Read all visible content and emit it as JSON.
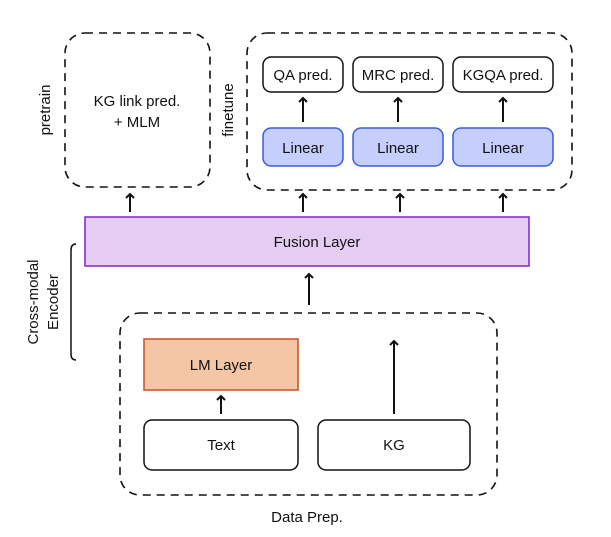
{
  "pretrain": {
    "label": "pretrain",
    "task_line1": "KG link pred.",
    "task_line2": "+ MLM"
  },
  "finetune": {
    "label": "finetune",
    "heads": [
      {
        "pred": "QA pred.",
        "layer": "Linear"
      },
      {
        "pred": "MRC pred.",
        "layer": "Linear"
      },
      {
        "pred": "KGQA pred.",
        "layer": "Linear"
      }
    ]
  },
  "fusion": {
    "label": "Fusion Layer"
  },
  "encoder": {
    "label_line1": "Cross-modal",
    "label_line2": "Encoder"
  },
  "data_prep": {
    "label": "Data Prep.",
    "lm_layer": "LM Layer",
    "text": "Text",
    "kg": "KG"
  },
  "colors": {
    "linear_fill": "#c5cefc",
    "linear_stroke": "#3b5bdb",
    "fusion_fill": "#e5ccf3",
    "fusion_stroke": "#8b2fc9",
    "lm_fill": "#f5c6a5",
    "lm_stroke": "#c8582c"
  }
}
